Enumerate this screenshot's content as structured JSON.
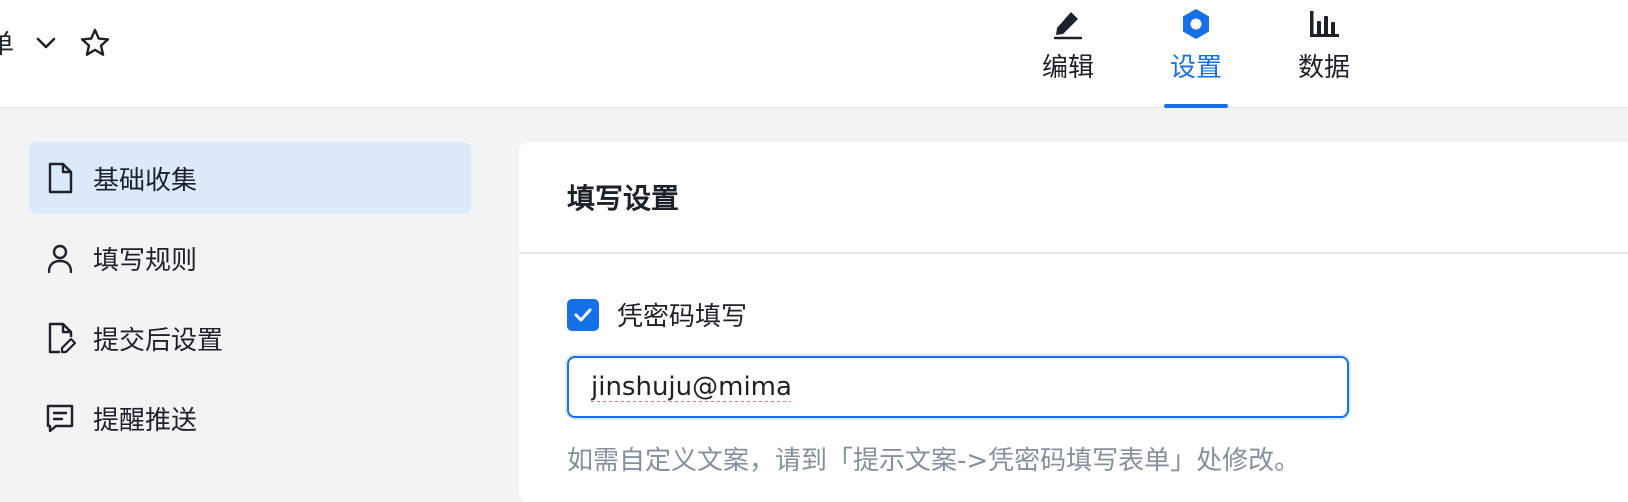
{
  "header": {
    "form_title_fragment": "单",
    "tabs": [
      {
        "label": "编辑",
        "icon": "pen-icon",
        "active": false
      },
      {
        "label": "设置",
        "icon": "settings-hexagon-icon",
        "active": true
      },
      {
        "label": "数据",
        "icon": "bar-chart-icon",
        "active": false
      }
    ],
    "accent_color": "#1670e8"
  },
  "sidebar": {
    "items": [
      {
        "label": "基础收集",
        "icon": "document-icon",
        "active": true
      },
      {
        "label": "填写规则",
        "icon": "user-icon",
        "active": false
      },
      {
        "label": "提交后设置",
        "icon": "document-edit-icon",
        "active": false
      },
      {
        "label": "提醒推送",
        "icon": "message-icon",
        "active": false
      }
    ]
  },
  "main": {
    "section_title": "填写设置",
    "password_checkbox": {
      "label": "凭密码填写",
      "checked": true
    },
    "password_input": {
      "value": "jinshuju@mima"
    },
    "hint": "如需自定义文案，请到「提示文案->凭密码填写表单」处修改。"
  }
}
